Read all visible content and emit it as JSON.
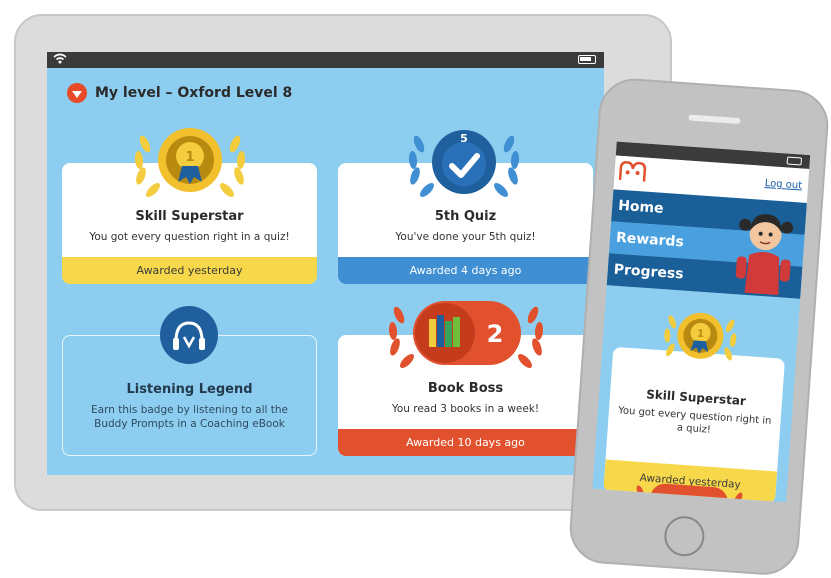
{
  "tablet": {
    "level_label": "My level – Oxford Level 8",
    "cards": [
      {
        "title": "Skill Superstar",
        "description": "You got every question right in a quiz!",
        "footer": "Awarded yesterday",
        "badge_text": "1"
      },
      {
        "title": "5th Quiz",
        "description": "You've done your 5th quiz!",
        "footer": "Awarded 4 days ago",
        "badge_text": "5"
      },
      {
        "title": "Listening Legend",
        "description": "Earn this badge by listening to all the Buddy Prompts in a Coaching eBook",
        "footer": ""
      },
      {
        "title": "Book Boss",
        "description": "You read 3 books in a week!",
        "footer": "Awarded 10 days ago",
        "badge_text": "2"
      }
    ]
  },
  "phone": {
    "logout": "Log out",
    "nav": [
      "Home",
      "Rewards",
      "Progress"
    ],
    "card": {
      "title": "Skill Superstar",
      "description": "You got every question right in a quiz!",
      "footer": "Awarded yesterday",
      "badge_text": "1"
    }
  },
  "colors": {
    "screen_bg": "#8dcef0",
    "yellow": "#f6d84a",
    "blue": "#3f8fd2",
    "red": "#e1512e",
    "nav_dark": "#1a5f98"
  }
}
